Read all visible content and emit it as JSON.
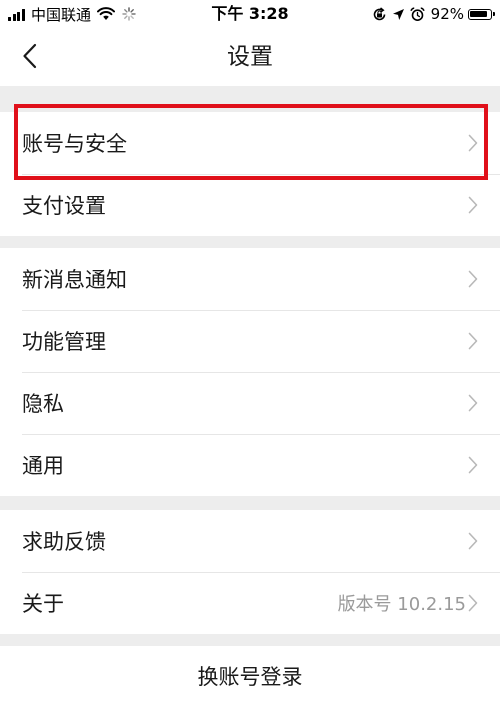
{
  "status_bar": {
    "carrier": "中国联通",
    "time": "下午 3:28",
    "battery_percent": "92%",
    "battery_level": 0.92
  },
  "nav": {
    "title": "设置",
    "back_icon": "chevron-left-icon"
  },
  "groups": [
    {
      "items": [
        {
          "label": "账号与安全"
        },
        {
          "label": "支付设置"
        }
      ]
    },
    {
      "items": [
        {
          "label": "新消息通知"
        },
        {
          "label": "功能管理"
        },
        {
          "label": "隐私"
        },
        {
          "label": "通用"
        }
      ]
    },
    {
      "items": [
        {
          "label": "求助反馈"
        },
        {
          "label": "关于",
          "value": "版本号 10.2.15"
        }
      ]
    }
  ],
  "switch_account": {
    "label": "换账号登录"
  },
  "colors": {
    "background": "#ededed",
    "highlight": "#e0101a",
    "chevron": "#b8b8b8"
  }
}
